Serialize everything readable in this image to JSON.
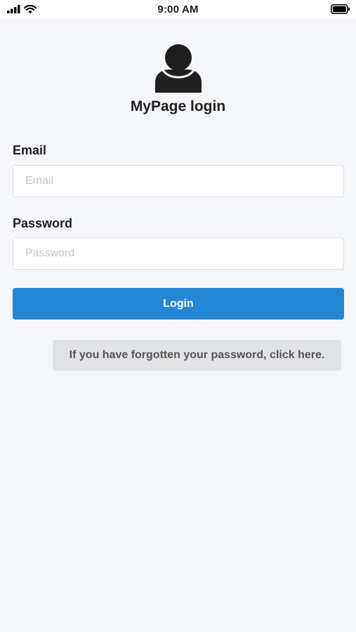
{
  "status_bar": {
    "time": "9:00 AM",
    "icons": [
      "cellular-signal-icon",
      "wifi-icon",
      "battery-icon"
    ]
  },
  "header": {
    "avatar_icon": "user-silhouette-icon",
    "title": "MyPage login"
  },
  "form": {
    "email": {
      "label": "Email",
      "placeholder": "Email",
      "value": ""
    },
    "password": {
      "label": "Password",
      "placeholder": "Password",
      "value": ""
    },
    "login_label": "Login",
    "forgot_label": "If you have forgotten your password, click here."
  },
  "colors": {
    "background": "#f5f6fa",
    "primary": "#2587d4",
    "secondary_button": "#e1e2e5"
  }
}
